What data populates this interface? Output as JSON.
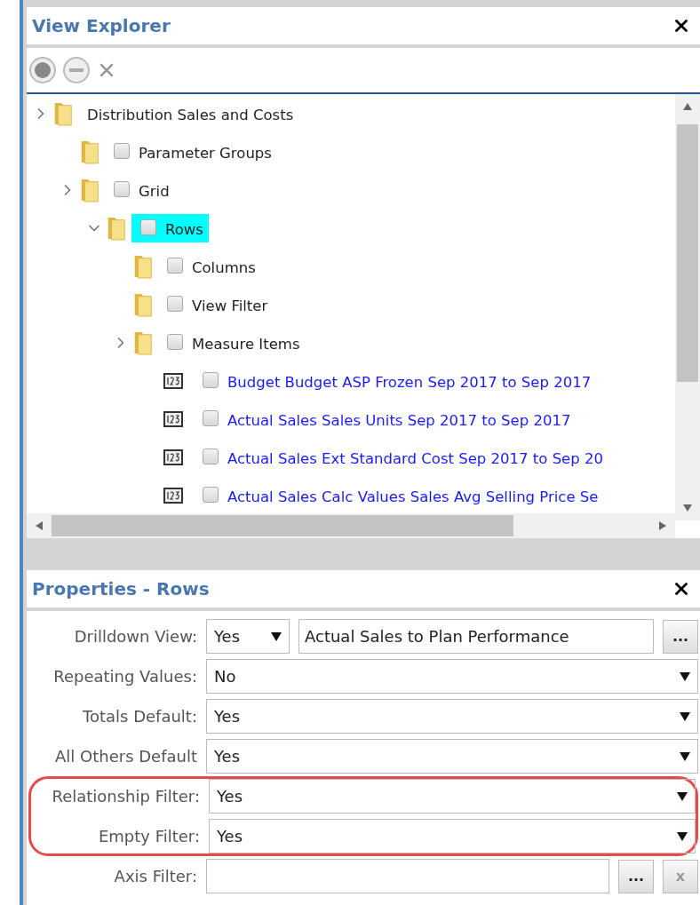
{
  "explorer": {
    "title": "View Explorer",
    "tree": [
      {
        "label": "Distribution Sales and Costs",
        "kind": "folder",
        "expanded": false,
        "selected": false,
        "children": [
          {
            "label": "Parameter Groups",
            "kind": "folder",
            "checked": false,
            "selected": false
          },
          {
            "label": "Grid",
            "kind": "folder",
            "expanded": false,
            "checked": false,
            "selected": false,
            "children": [
              {
                "label": "Rows",
                "kind": "folder",
                "expanded": true,
                "checked": false,
                "selected": true,
                "children": [
                  {
                    "label": "Columns",
                    "kind": "folder",
                    "checked": false,
                    "selected": false
                  },
                  {
                    "label": "View Filter",
                    "kind": "folder",
                    "checked": false,
                    "selected": false
                  },
                  {
                    "label": "Measure Items",
                    "kind": "folder",
                    "expanded": false,
                    "checked": false,
                    "selected": false,
                    "children": [
                      {
                        "label": "Budget Budget ASP Frozen Sep 2017 to Sep 2017",
                        "kind": "measure",
                        "checked": false,
                        "selected": false
                      },
                      {
                        "label": "Actual Sales Sales Units Sep 2017 to Sep 2017",
                        "kind": "measure",
                        "checked": false,
                        "selected": false
                      },
                      {
                        "label": "Actual Sales Ext Standard Cost Sep 2017 to Sep 20",
                        "kind": "measure",
                        "checked": false,
                        "selected": false
                      },
                      {
                        "label": "Actual Sales Calc Values Sales Avg Selling Price Se",
                        "kind": "measure",
                        "checked": false,
                        "selected": false
                      }
                    ]
                  }
                ]
              }
            ]
          }
        ]
      }
    ]
  },
  "properties": {
    "title": "Properties - Rows",
    "rows": [
      {
        "label": "Drilldown View:",
        "kind": "drilldown",
        "value": "Yes",
        "view": "Actual Sales to Plan Performance",
        "button": "...",
        "highlighted": false
      },
      {
        "label": "Repeating Values:",
        "kind": "select",
        "value": "No",
        "highlighted": false
      },
      {
        "label": "Totals Default:",
        "kind": "select",
        "value": "Yes",
        "highlighted": false
      },
      {
        "label": "All Others Default",
        "kind": "select",
        "value": "Yes",
        "highlighted": false
      },
      {
        "label": "Relationship Filter:",
        "kind": "select",
        "value": "Yes",
        "highlighted": true
      },
      {
        "label": "Empty Filter:",
        "kind": "select",
        "value": "Yes",
        "highlighted": true
      },
      {
        "label": "Axis Filter:",
        "kind": "filter",
        "button": "...",
        "clear": "x",
        "highlighted": false
      }
    ]
  }
}
